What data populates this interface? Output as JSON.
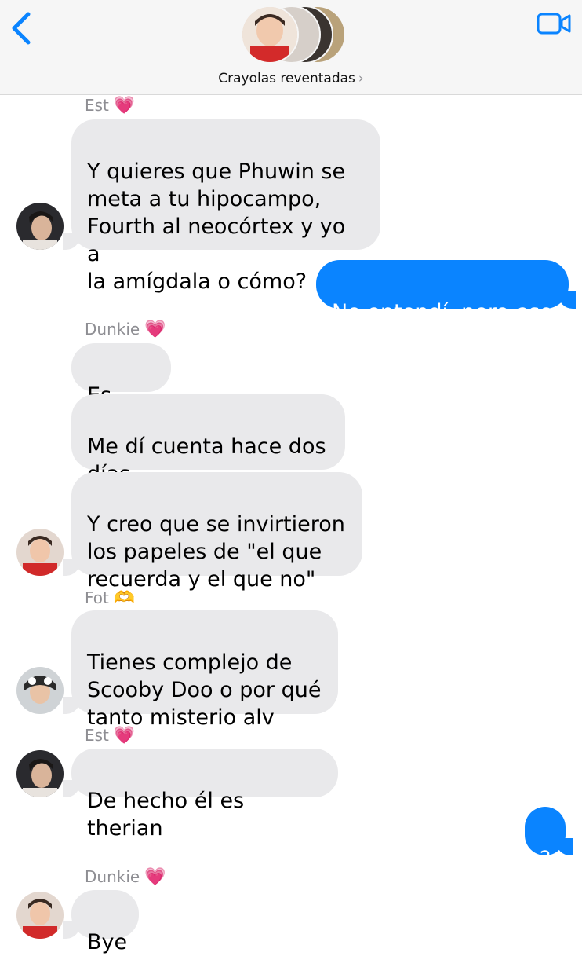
{
  "header": {
    "group_name": "Crayolas reventadas",
    "chevron": "›",
    "back_icon": "chevron-left-icon",
    "video_icon": "video-camera-icon",
    "accent": "#0a84ff"
  },
  "messages": [
    {
      "sender": "Est",
      "emoji": "💗",
      "text": "Y quieres que Phuwin se\nmeta a tu hipocampo,\nFourth al neocórtex y yo a\nla amígdala o cómo?"
    },
    {
      "text": "No entendí, pero eso"
    },
    {
      "sender": "Dunkie",
      "emoji": "💗",
      "text": "Es que"
    },
    {
      "text": "Me dí cuenta hace dos\ndías"
    },
    {
      "text": "Y creo que se invirtieron\nlos papeles de \"el que\nrecuerda y el que no\""
    },
    {
      "sender": "Fot",
      "emoji": "🫶",
      "text": "Tienes complejo de\nScooby Doo o por qué\ntanto misterio alv"
    },
    {
      "sender": "Est",
      "emoji": "💗",
      "text": "De hecho él es therian"
    },
    {
      "text": "?"
    },
    {
      "sender": "Dunkie",
      "emoji": "💗",
      "text": "Bye"
    }
  ],
  "colors": {
    "incoming_bubble": "#e9e9eb",
    "outgoing_bubble": "#0a84ff",
    "sender_label": "#8e8e93"
  }
}
